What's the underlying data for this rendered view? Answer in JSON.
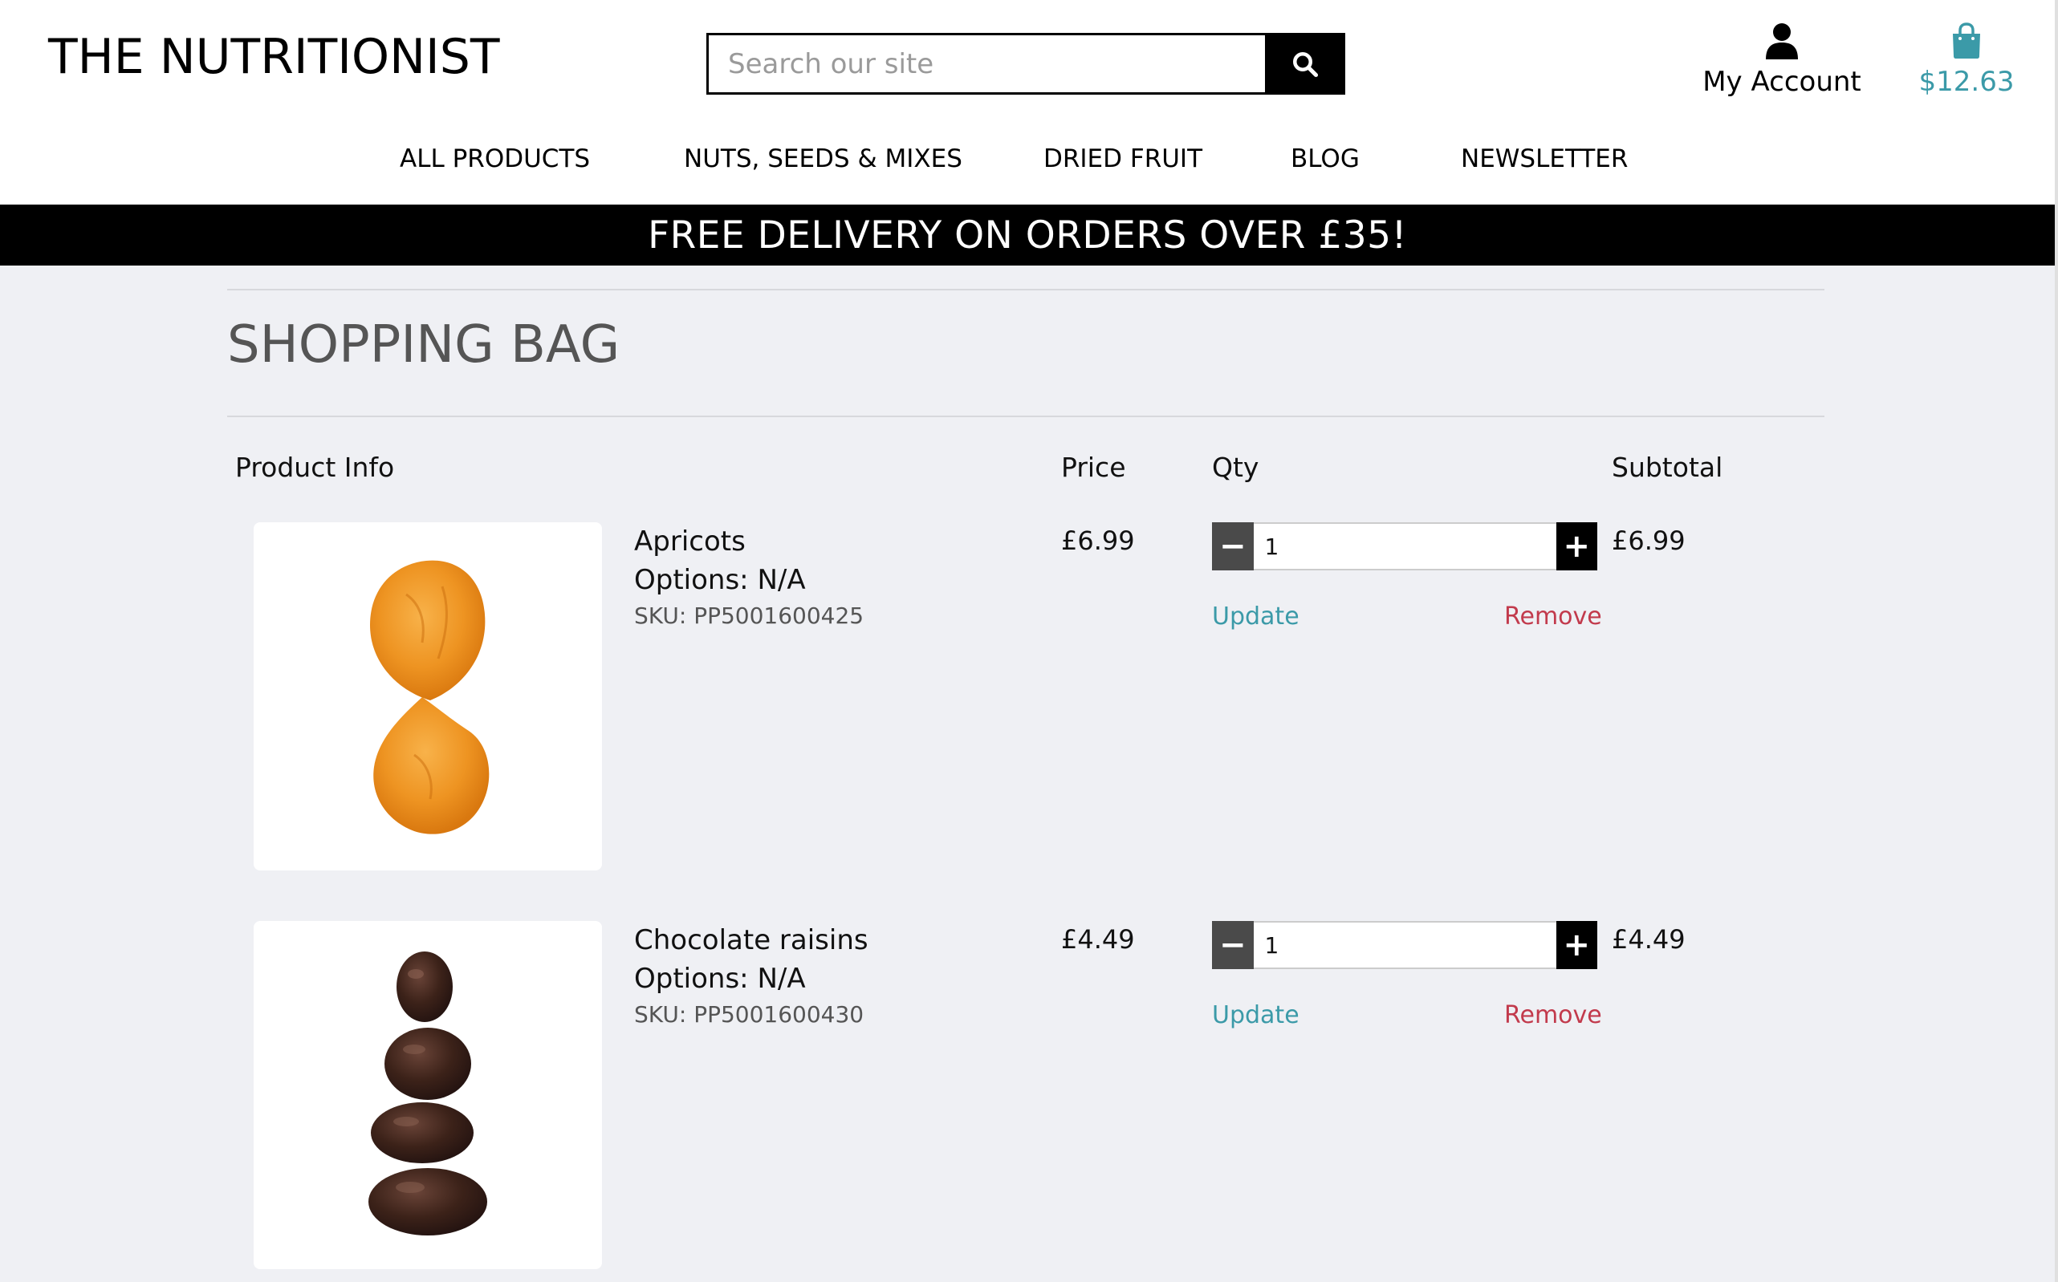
{
  "brand": {
    "logo_text": "THE NUTRITIONIST"
  },
  "search": {
    "placeholder": "Search our site",
    "button_icon": "search-icon"
  },
  "account": {
    "label": "My Account",
    "icon": "user-icon"
  },
  "cart": {
    "amount": "$12.63",
    "icon": "shopping-bag-icon",
    "accent_color": "#3b9aa8"
  },
  "nav": {
    "items": [
      {
        "label": "ALL PRODUCTS"
      },
      {
        "label": "NUTS, SEEDS & MIXES"
      },
      {
        "label": "DRIED FRUIT"
      },
      {
        "label": "BLOG"
      },
      {
        "label": "NEWSLETTER"
      }
    ]
  },
  "banner": {
    "text": "FREE DELIVERY ON ORDERS OVER £35!"
  },
  "bag": {
    "title": "SHOPPING BAG",
    "columns": {
      "product_info": "Product Info",
      "price": "Price",
      "qty": "Qty",
      "subtotal": "Subtotal"
    },
    "items": [
      {
        "name": "Apricots",
        "options": "Options: N/A",
        "sku": "SKU: PP5001600425",
        "price": "£6.99",
        "qty": "1",
        "subtotal": "£6.99",
        "update_label": "Update",
        "remove_label": "Remove"
      },
      {
        "name": "Chocolate raisins",
        "options": "Options: N/A",
        "sku": "SKU: PP5001600430",
        "price": "£4.49",
        "qty": "1",
        "subtotal": "£4.49",
        "update_label": "Update",
        "remove_label": "Remove"
      }
    ]
  },
  "colors": {
    "update_link": "#3b9aa8",
    "remove_link": "#c23a4c",
    "banner_bg": "#000000",
    "page_bg": "#eff0f4"
  }
}
